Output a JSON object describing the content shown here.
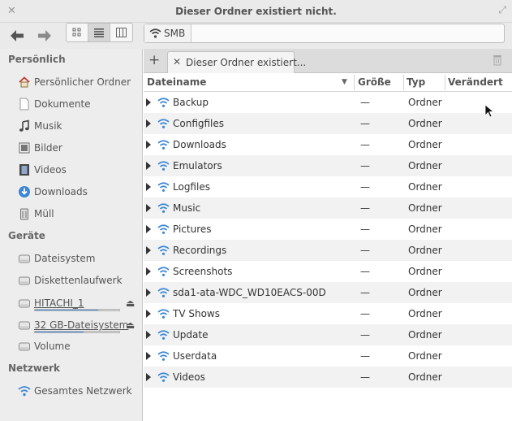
{
  "window": {
    "title": "Dieser Ordner existiert nicht.",
    "close_glyph": "✕",
    "maximize_glyph": "⤢"
  },
  "toolbar": {
    "back_icon": "arrow-left-icon",
    "forward_icon": "arrow-right-icon",
    "views": [
      "icon-view",
      "list-view",
      "column-view"
    ],
    "active_view": "list-view",
    "path": [
      "SMB"
    ]
  },
  "sidebar": {
    "sections": [
      {
        "title": "Persönlich",
        "items": [
          {
            "label": "Persönlicher Ordner",
            "icon": "home-icon"
          },
          {
            "label": "Dokumente",
            "icon": "document-icon"
          },
          {
            "label": "Musik",
            "icon": "music-icon"
          },
          {
            "label": "Bilder",
            "icon": "pictures-icon"
          },
          {
            "label": "Videos",
            "icon": "video-icon"
          },
          {
            "label": "Downloads",
            "icon": "download-icon"
          },
          {
            "label": "Müll",
            "icon": "trash-icon"
          }
        ]
      },
      {
        "title": "Geräte",
        "items": [
          {
            "label": "Dateisystem",
            "icon": "drive-icon"
          },
          {
            "label": "Diskettenlaufwerk",
            "icon": "floppy-icon"
          },
          {
            "label": "HITACHI_1",
            "icon": "drive-icon",
            "usage": 0.75,
            "eject": true
          },
          {
            "label": "32 GB-Dateisystem",
            "icon": "drive-icon",
            "usage": 0.58,
            "eject": true
          },
          {
            "label": "Volume",
            "icon": "drive-icon"
          }
        ]
      },
      {
        "title": "Netzwerk",
        "items": [
          {
            "label": "Gesamtes Netzwerk",
            "icon": "network-icon"
          }
        ]
      }
    ]
  },
  "tabs": [
    {
      "label": "Dieser Ordner existiert..."
    }
  ],
  "columns": {
    "name": "Dateiname",
    "size": "Größe",
    "type": "Typ",
    "modified": "Verändert"
  },
  "files": [
    {
      "name": "Backup",
      "size": "—",
      "type": "Ordner"
    },
    {
      "name": "Configfiles",
      "size": "—",
      "type": "Ordner"
    },
    {
      "name": "Downloads",
      "size": "—",
      "type": "Ordner"
    },
    {
      "name": "Emulators",
      "size": "—",
      "type": "Ordner"
    },
    {
      "name": "Logfiles",
      "size": "—",
      "type": "Ordner"
    },
    {
      "name": "Music",
      "size": "—",
      "type": "Ordner"
    },
    {
      "name": "Pictures",
      "size": "—",
      "type": "Ordner"
    },
    {
      "name": "Recordings",
      "size": "—",
      "type": "Ordner"
    },
    {
      "name": "Screenshots",
      "size": "—",
      "type": "Ordner"
    },
    {
      "name": "sda1-ata-WDC_WD10EACS-00D",
      "size": "—",
      "type": "Ordner"
    },
    {
      "name": "TV Shows",
      "size": "—",
      "type": "Ordner"
    },
    {
      "name": "Update",
      "size": "—",
      "type": "Ordner"
    },
    {
      "name": "Userdata",
      "size": "—",
      "type": "Ordner"
    },
    {
      "name": "Videos",
      "size": "—",
      "type": "Ordner"
    }
  ],
  "colors": {
    "accent": "#4a90d9",
    "sidebar_bg": "#ededed",
    "row_alt": "#f2f2f2"
  }
}
